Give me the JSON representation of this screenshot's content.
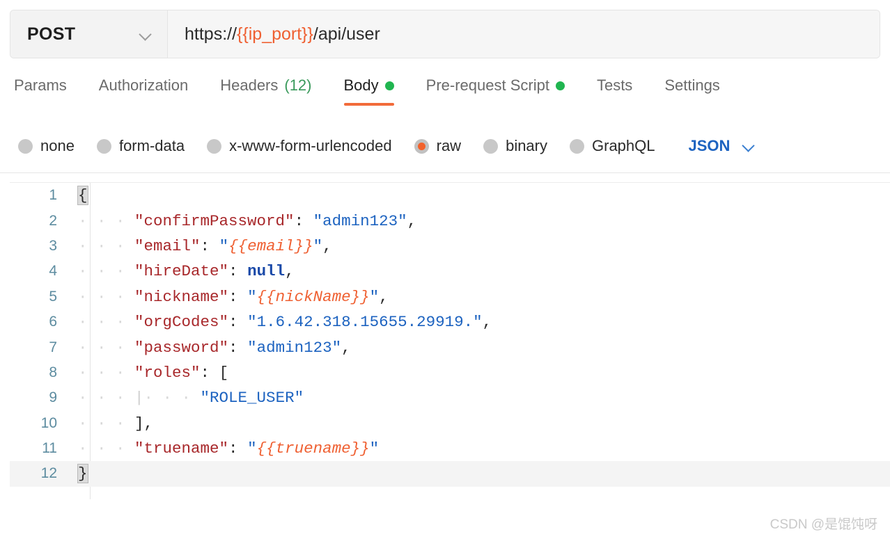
{
  "request": {
    "method": "POST",
    "method_dropdown_icon": "chevron-down-icon",
    "url_prefix": "https://",
    "url_variable": "{{ip_port}}",
    "url_suffix": "/api/user"
  },
  "tabs": [
    {
      "label": "Params",
      "active": false,
      "badge": "",
      "dot": false
    },
    {
      "label": "Authorization",
      "active": false,
      "badge": "",
      "dot": false
    },
    {
      "label": "Headers",
      "active": false,
      "badge": "(12)",
      "dot": false
    },
    {
      "label": "Body",
      "active": true,
      "badge": "",
      "dot": true
    },
    {
      "label": "Pre-request Script",
      "active": false,
      "badge": "",
      "dot": true
    },
    {
      "label": "Tests",
      "active": false,
      "badge": "",
      "dot": false
    },
    {
      "label": "Settings",
      "active": false,
      "badge": "",
      "dot": false
    }
  ],
  "body_types": [
    {
      "label": "none",
      "checked": false
    },
    {
      "label": "form-data",
      "checked": false
    },
    {
      "label": "x-www-form-urlencoded",
      "checked": false
    },
    {
      "label": "raw",
      "checked": true
    },
    {
      "label": "binary",
      "checked": false
    },
    {
      "label": "GraphQL",
      "checked": false
    }
  ],
  "format_select": {
    "value": "JSON",
    "icon": "chevron-down-icon"
  },
  "editor": {
    "line_numbers": [
      "1",
      "2",
      "3",
      "4",
      "5",
      "6",
      "7",
      "8",
      "9",
      "10",
      "11",
      "12"
    ],
    "active_line": 12,
    "raw_body": "{\n    \"confirmPassword\": \"admin123\",\n    \"email\": \"{{email}}\",\n    \"hireDate\": null,\n    \"nickname\": \"{{nickName}}\",\n    \"orgCodes\": \"1.6.42.318.15655.29919.\",\n    \"password\": \"admin123\",\n    \"roles\": [\n        \"ROLE_USER\"\n    ],\n    \"truename\": \"{{truename}}\"\n}",
    "json_fields": {
      "confirmPassword": "admin123",
      "email": "{{email}}",
      "hireDate": null,
      "nickname": "{{nickName}}",
      "orgCodes": "1.6.42.318.15655.29919.",
      "password": "admin123",
      "roles": [
        "ROLE_USER"
      ],
      "truename": "{{truename}}"
    },
    "tokens": {
      "l1": {
        "brace": "{"
      },
      "l2": {
        "key": "\"confirmPassword\"",
        "colon": ":",
        "value": "\"admin123\"",
        "comma": ","
      },
      "l3": {
        "key": "\"email\"",
        "colon": ":",
        "quote": "\"",
        "value": "{{email}}",
        "comma": ","
      },
      "l4": {
        "key": "\"hireDate\"",
        "colon": ":",
        "value": "null",
        "comma": ","
      },
      "l5": {
        "key": "\"nickname\"",
        "colon": ":",
        "quote": "\"",
        "value": "{{nickName}}",
        "comma": ","
      },
      "l6": {
        "key": "\"orgCodes\"",
        "colon": ":",
        "value": "\"1.6.42.318.15655.29919.\"",
        "comma": ","
      },
      "l7": {
        "key": "\"password\"",
        "colon": ":",
        "value": "\"admin123\"",
        "comma": ","
      },
      "l8": {
        "key": "\"roles\"",
        "colon": ":",
        "bracket": "["
      },
      "l9": {
        "value": "\"ROLE_USER\""
      },
      "l10": {
        "bracket": "]",
        "comma": ","
      },
      "l11": {
        "key": "\"truename\"",
        "colon": ":",
        "quote": "\"",
        "value": "{{truename}}"
      },
      "l12": {
        "brace": "}"
      }
    }
  },
  "watermark": "CSDN @是馄饨呀",
  "colors": {
    "accent_orange": "#f26b3a",
    "status_green": "#20b550",
    "json_blue": "#1d63c0",
    "key_red": "#a8282b",
    "variable_orange": "#ef6032"
  }
}
